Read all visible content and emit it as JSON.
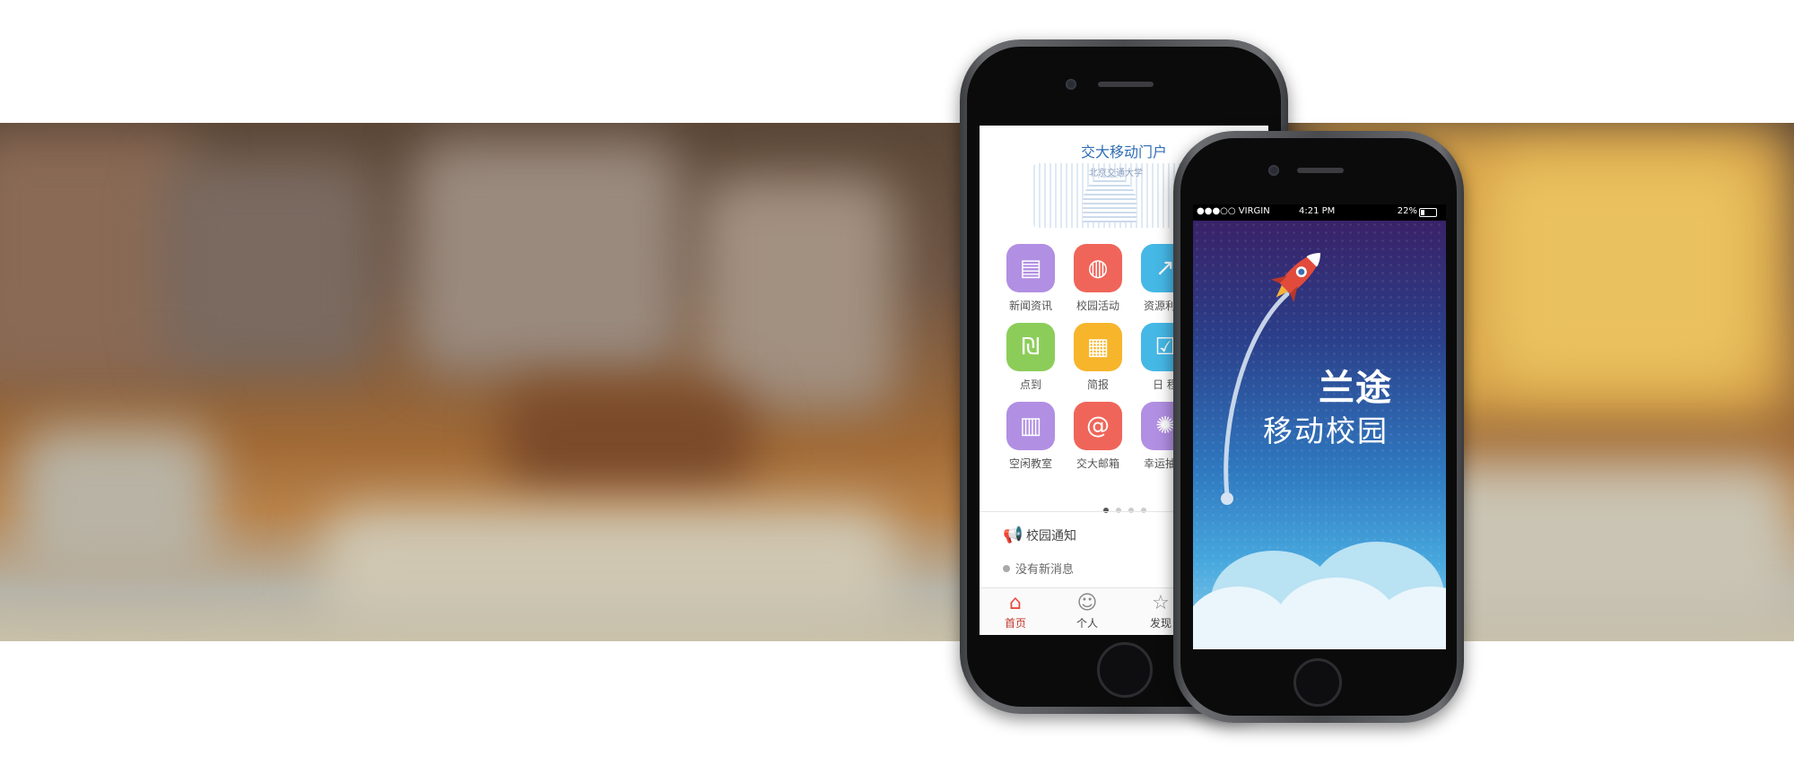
{
  "phone1": {
    "portal_title": "交大移动门户",
    "campus_caption": "北京交通大学",
    "apps": [
      {
        "label": "新闻资讯",
        "icon": "news-icon",
        "color": "#b18fe3",
        "glyph": "▤"
      },
      {
        "label": "校园活动",
        "icon": "activity-icon",
        "color": "#f0655a",
        "glyph": "◍"
      },
      {
        "label": "资源利用",
        "icon": "chart-icon",
        "color": "#45b8e6",
        "glyph": "↗"
      },
      {
        "label": "点到",
        "icon": "checkin-icon",
        "color": "#8ccd5a",
        "glyph": "₪"
      },
      {
        "label": "简报",
        "icon": "document-icon",
        "color": "#f7b52c",
        "glyph": "▦"
      },
      {
        "label": "日 程",
        "icon": "calendar-check-icon",
        "color": "#45b8e6",
        "glyph": "☑"
      },
      {
        "label": "空闲教室",
        "icon": "classroom-icon",
        "color": "#b18fe3",
        "glyph": "▥"
      },
      {
        "label": "交大邮箱",
        "icon": "mail-icon",
        "color": "#f0655a",
        "glyph": "@"
      },
      {
        "label": "幸运抽奖",
        "icon": "lottery-icon",
        "color": "#b18fe3",
        "glyph": "✺"
      }
    ],
    "notice_title": "校园通知",
    "notice_empty": "没有新消息",
    "tabs": [
      {
        "label": "首页",
        "icon": "home-icon",
        "glyph": "⌂"
      },
      {
        "label": "个人",
        "icon": "person-icon",
        "glyph": "☺"
      },
      {
        "label": "发现",
        "icon": "star-icon",
        "glyph": "☆"
      }
    ]
  },
  "phone2": {
    "status": {
      "carrier": "●●●○○ VIRGIN",
      "time": "4:21 PM",
      "battery": "22%"
    },
    "brand": "兰途",
    "slogan": "移动校园"
  }
}
